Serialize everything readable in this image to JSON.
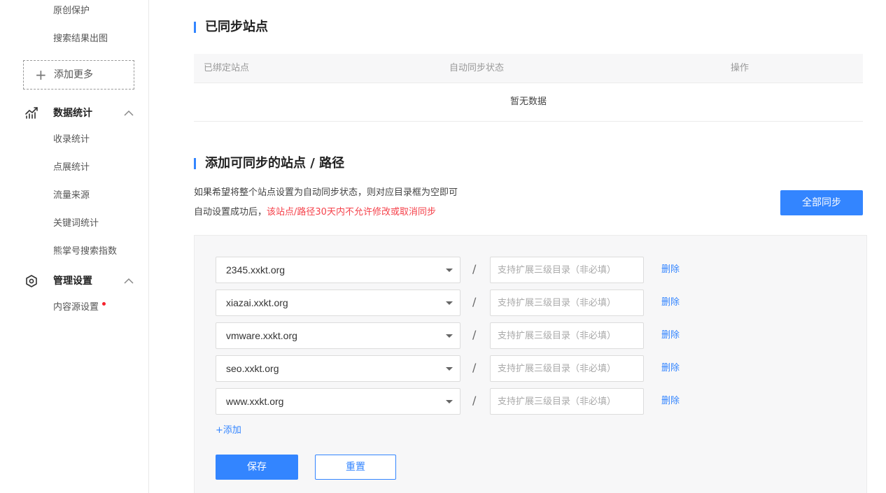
{
  "sidebar": {
    "top_items": [
      "原创保护",
      "搜索结果出图"
    ],
    "add_more_label": "添加更多",
    "groups": [
      {
        "label": "数据统计",
        "icon": "chart-trend-icon",
        "items": [
          "收录统计",
          "点展统计",
          "流量来源",
          "关键词统计",
          "熊掌号搜索指数"
        ]
      },
      {
        "label": "管理设置",
        "icon": "hexagon-settings-icon",
        "items": [
          "内容源设置"
        ]
      }
    ]
  },
  "synced": {
    "title": "已同步站点",
    "columns": [
      "已绑定站点",
      "自动同步状态",
      "操作"
    ],
    "empty_text": "暂无数据"
  },
  "add_section": {
    "title": "添加可同步的站点 / 路径",
    "desc_line1": "如果希望将整个站点设置为自动同步状态，则对应目录框为空即可",
    "desc_line2_prefix": "自动设置成功后，",
    "desc_line2_warn": "该站点/路径30天内不允许修改或取消同步",
    "sync_all_label": "全部同步",
    "rows": [
      {
        "site": "2345.xxkt.org"
      },
      {
        "site": "xiazai.xxkt.org"
      },
      {
        "site": "vmware.xxkt.org"
      },
      {
        "site": "seo.xxkt.org"
      },
      {
        "site": "www.xxkt.org"
      }
    ],
    "separator": "/",
    "dir_placeholder": "支持扩展三级目录（非必填）",
    "delete_label": "删除",
    "add_label": "+添加",
    "save_label": "保存",
    "reset_label": "重置"
  },
  "colors": {
    "accent": "#3385ff",
    "warning": "#f5424b",
    "panel_bg": "#f7f7f8"
  }
}
